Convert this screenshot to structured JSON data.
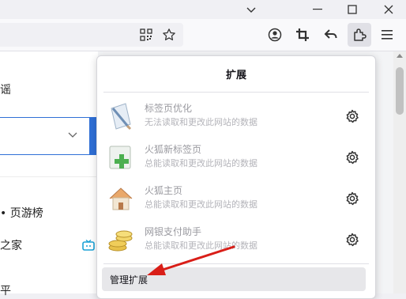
{
  "page": {
    "tab_partial": "谣",
    "list_heading": "• 页游榜",
    "list_item_1": "之家",
    "list_item_2": "平"
  },
  "extensions_panel": {
    "title": "扩展",
    "items": [
      {
        "name": "标签页优化",
        "desc": "无法读取和更改此网站的数据",
        "icon": "tab-optimizer-icon"
      },
      {
        "name": "火狐新标签页",
        "desc": "总能读取和更改此网站的数据",
        "icon": "new-tab-icon"
      },
      {
        "name": "火狐主页",
        "desc": "总能读取和更改此网站的数据",
        "icon": "home-icon"
      },
      {
        "name": "网银支付助手",
        "desc": "总能读取和更改此网站的数据",
        "icon": "coins-icon"
      }
    ],
    "manage_label": "管理扩展"
  },
  "colors": {
    "accent_blue": "#2f6fd6",
    "annotation_red": "#d91e18"
  }
}
